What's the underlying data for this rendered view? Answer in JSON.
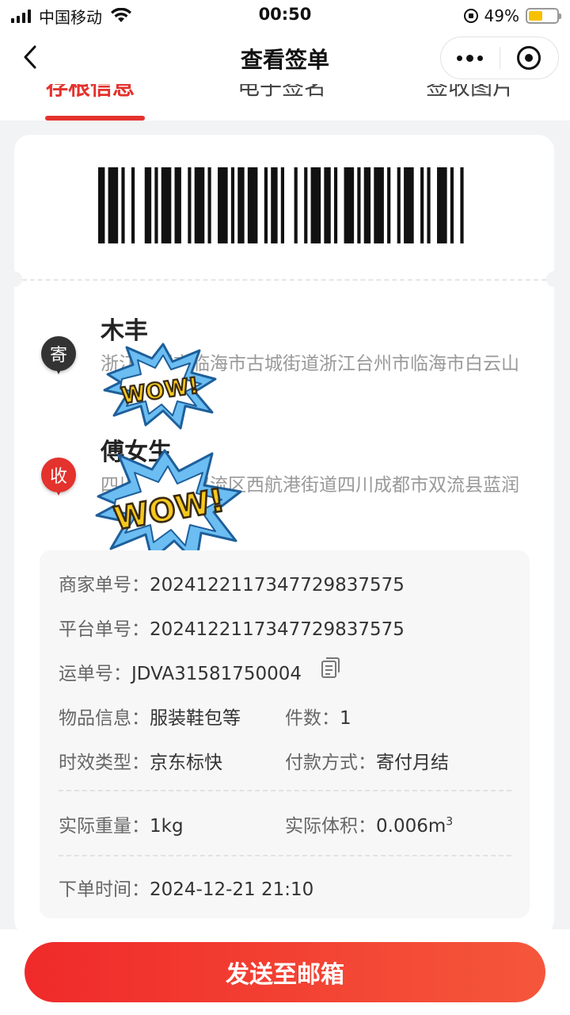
{
  "status_bar": {
    "carrier": "中国移动",
    "time": "00:50",
    "battery_percent": "49%",
    "battery_level": 0.49,
    "battery_color": "#f7c100"
  },
  "nav": {
    "title": "查看签单",
    "back_icon": "chevron-left-icon",
    "more_icon": "more-dots-icon",
    "close_icon": "target-icon"
  },
  "tabs": [
    {
      "label": "存根信息",
      "active": true
    },
    {
      "label": "电子签名",
      "active": false
    },
    {
      "label": "签收图片",
      "active": false
    }
  ],
  "sender": {
    "badge": "寄",
    "name": "木丰",
    "address": "浙江台州市临海市古城街道浙江台州市临海市白云山"
  },
  "receiver": {
    "badge": "收",
    "name": "傅女生",
    "address": "四川成都市双流区西航港街道四川成都市双流县蓝润"
  },
  "stickers": {
    "text": "WOW!"
  },
  "info": {
    "merchant_order_label": "商家单号：",
    "merchant_order_value": "20241221173477298375 75",
    "platform_order_label": "平台单号：",
    "platform_order_value": "2024122117347729837575",
    "waybill_label": "运单号：",
    "waybill_value": "JDVA31581750004",
    "goods_label": "物品信息：",
    "goods_value": "服装鞋包等",
    "count_label": "件数：",
    "count_value": "1",
    "service_label": "时效类型：",
    "service_value": "京东标快",
    "payment_label": "付款方式：",
    "payment_value": "寄付月结",
    "weight_label": "实际重量：",
    "weight_value": "1kg",
    "volume_label": "实际体积：",
    "volume_value": "0.006m",
    "volume_unit_sup": "3",
    "order_time_label": "下单时间：",
    "order_time_value": "2024-12-21 21:10"
  },
  "actions": {
    "send_email": "发送至邮箱"
  },
  "colors": {
    "accent": "#e4322d"
  }
}
